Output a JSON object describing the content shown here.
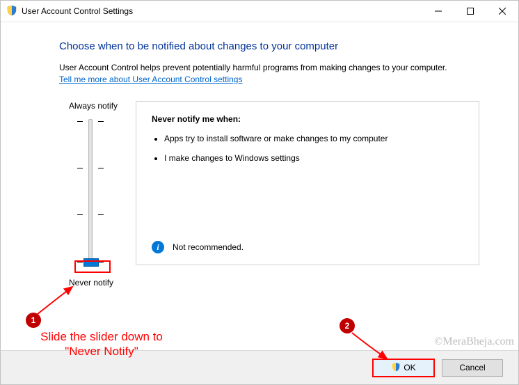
{
  "window": {
    "title": "User Account Control Settings"
  },
  "heading": "Choose when to be notified about changes to your computer",
  "help_text": "User Account Control helps prevent potentially harmful programs from making changes to your computer.",
  "help_link": "Tell me more about User Account Control settings",
  "slider": {
    "top_label": "Always notify",
    "bottom_label": "Never notify"
  },
  "info": {
    "title": "Never notify me when:",
    "bullets": [
      "Apps try to install software or make changes to my computer",
      "I make changes to Windows settings"
    ],
    "footer": "Not recommended."
  },
  "buttons": {
    "ok": "OK",
    "cancel": "Cancel"
  },
  "annotations": {
    "step1": "1",
    "step2": "2",
    "step1_text": "Slide the slider down to\n\"Never Notify\"",
    "watermark": "©MeraBheja.com"
  }
}
